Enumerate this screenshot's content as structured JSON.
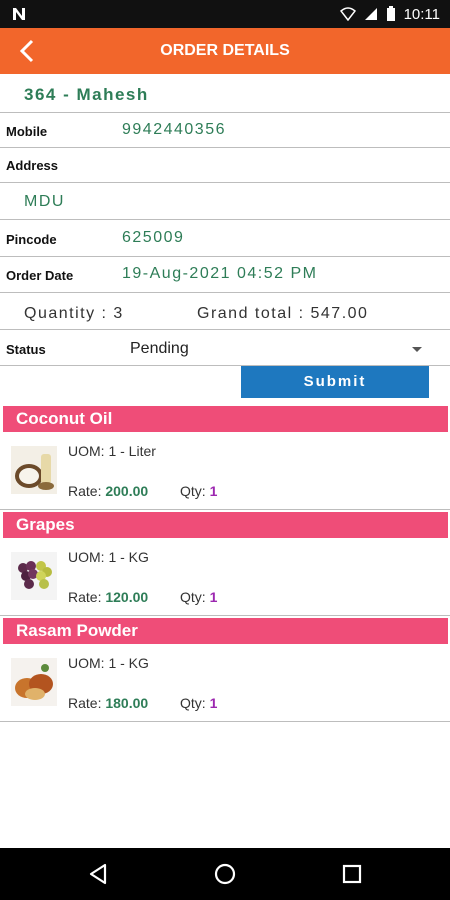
{
  "status_bar": {
    "time": "10:11",
    "icons": [
      "n-logo-icon",
      "wifi-icon",
      "signal-icon",
      "battery-icon"
    ]
  },
  "appbar": {
    "title": "ORDER DETAILS"
  },
  "order": {
    "customer": "364 - Mahesh",
    "mobile_label": "Mobile",
    "mobile": "9942440356",
    "address_label": "Address",
    "address": "MDU",
    "pincode_label": "Pincode",
    "pincode": "625009",
    "order_date_label": "Order Date",
    "order_date": "19-Aug-2021 04:52 PM",
    "quantity_text": "Quantity : 3",
    "grand_total_text": "Grand total : 547.00",
    "status_label": "Status",
    "status_value": "Pending",
    "submit_label": "Submit"
  },
  "products": [
    {
      "name": "Coconut Oil",
      "uom": "UOM: 1 - Liter",
      "rate_label": "Rate:",
      "rate": "200.00",
      "qty_label": "Qty:",
      "qty": "1",
      "image_icon": "coconut-oil-image"
    },
    {
      "name": "Grapes",
      "uom": "UOM: 1 - KG",
      "rate_label": "Rate:",
      "rate": "120.00",
      "qty_label": "Qty:",
      "qty": "1",
      "image_icon": "grapes-image"
    },
    {
      "name": "Rasam Powder",
      "uom": "UOM: 1 - KG",
      "rate_label": "Rate:",
      "rate": "180.00",
      "qty_label": "Qty:",
      "qty": "1",
      "image_icon": "rasam-powder-image"
    }
  ],
  "colors": {
    "appbar": "#f2662b",
    "product_header": "#ef4d78",
    "submit": "#1e78bf",
    "value_text": "#2e7d57",
    "qty_value": "#9c27b0"
  },
  "nav": {
    "icons": [
      "back-nav-icon",
      "home-nav-icon",
      "recents-nav-icon"
    ]
  }
}
